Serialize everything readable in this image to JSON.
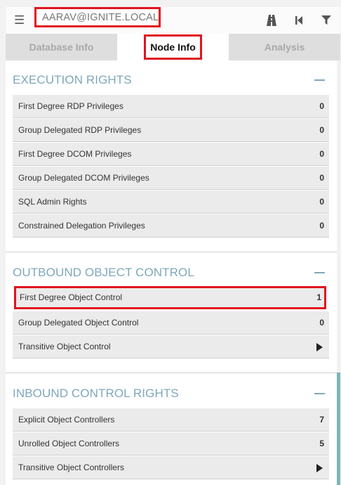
{
  "search": {
    "value": "AARAV@IGNITE.LOCAL"
  },
  "toolbar": {
    "icons": [
      "pathfinding-icon",
      "back-icon",
      "filter-icon"
    ]
  },
  "tabs": [
    {
      "label": "Database Info",
      "active": false
    },
    {
      "label": "Node Info",
      "active": true
    },
    {
      "label": "Analysis",
      "active": false
    }
  ],
  "sections": {
    "execution": {
      "title": "EXECUTION RIGHTS",
      "rows": [
        {
          "label": "First Degree RDP Privileges",
          "count": "0"
        },
        {
          "label": "Group Delegated RDP Privileges",
          "count": "0"
        },
        {
          "label": "First Degree DCOM Privileges",
          "count": "0"
        },
        {
          "label": "Group Delegated DCOM Privileges",
          "count": "0"
        },
        {
          "label": "SQL Admin Rights",
          "count": "0"
        },
        {
          "label": "Constrained Delegation Privileges",
          "count": "0"
        }
      ]
    },
    "outbound": {
      "title": "OUTBOUND OBJECT CONTROL",
      "rows": [
        {
          "label": "First Degree Object Control",
          "count": "1",
          "highlight": true
        },
        {
          "label": "Group Delegated Object Control",
          "count": "0"
        },
        {
          "label": "Transitive Object Control",
          "count": null
        }
      ]
    },
    "inbound": {
      "title": "INBOUND CONTROL RIGHTS",
      "rows": [
        {
          "label": "Explicit Object Controllers",
          "count": "7"
        },
        {
          "label": "Unrolled Object Controllers",
          "count": "5"
        },
        {
          "label": "Transitive Object Controllers",
          "count": null
        }
      ]
    }
  },
  "colors": {
    "accent": "#7fa7bc",
    "highlight": "#e0141e",
    "row_bg": "#ebebeb"
  }
}
